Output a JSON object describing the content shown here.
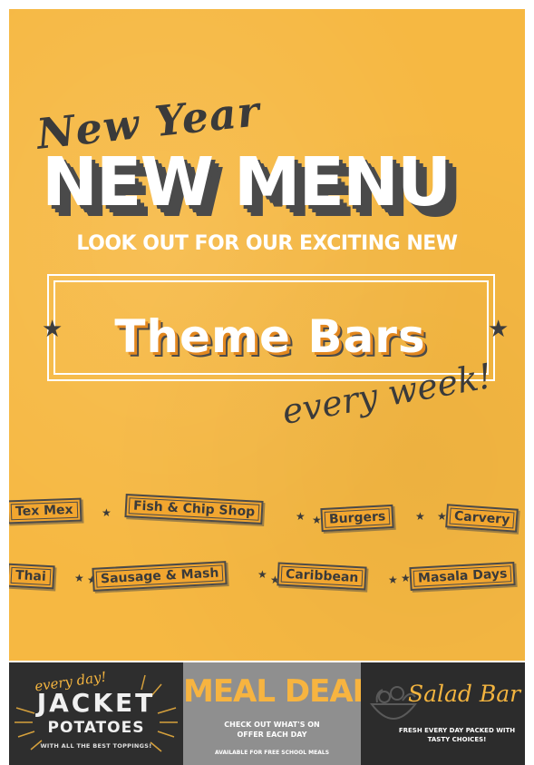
{
  "header": {
    "new_year": "New Year",
    "new_menu": "NEW MENU",
    "look_out": "LOOK OUT FOR OUR EXCITING NEW",
    "theme_bars": "Theme Bars",
    "every_week": "every week!"
  },
  "themes": [
    "Tex Mex",
    "Fish & Chip Shop",
    "Burgers",
    "Carvery",
    "Thai",
    "Sausage & Mash",
    "Caribbean",
    "Masala Days"
  ],
  "footer": {
    "jacket": {
      "every_day": "every day!",
      "title": "JACKET",
      "subtitle": "POTATOES",
      "note": "WITH ALL THE BEST TOPPINGS!"
    },
    "meal_deal": {
      "title": "MEAL DEAL",
      "check": "CHECK OUT WHAT'S ON OFFER EACH DAY",
      "available": "AVAILABLE FOR FREE SCHOOL MEALS"
    },
    "salad": {
      "title": "Salad Bar",
      "note": "FRESH EVERY DAY PACKED WITH TASTY CHOICES!"
    }
  },
  "colors": {
    "background": "#f6b842",
    "dark": "#3a3a3a",
    "accent": "#e2871f"
  },
  "icons": [
    "star-icon",
    "salad-bowl-icon",
    "sunburst-decoration"
  ]
}
